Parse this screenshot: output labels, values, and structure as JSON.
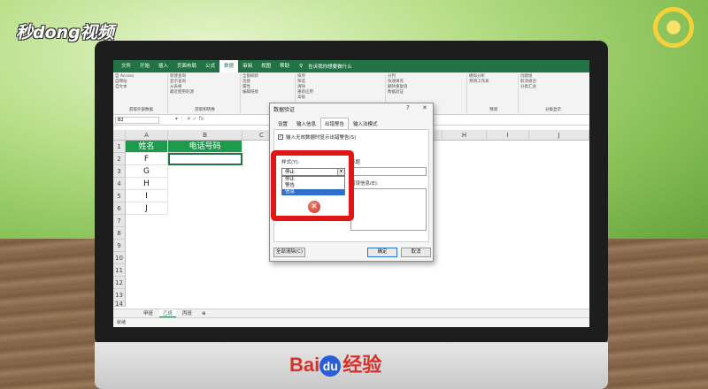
{
  "logo": "秒dong视频",
  "footer_logo": {
    "bai": "Bai",
    "du": "du",
    "jingyan": "经验"
  },
  "ribbon": {
    "tabs": [
      "文件",
      "开始",
      "插入",
      "页面布局",
      "公式",
      "数据",
      "审阅",
      "视图",
      "帮助"
    ],
    "active_tab": "数据",
    "tell_me": "告诉我你想要做什么",
    "groups": [
      {
        "label": "获取外部数据",
        "items": [
          "自 Access",
          "自网站",
          "自文本"
        ]
      },
      {
        "label": "获取和转换",
        "items": [
          "新建查询",
          "显示查询",
          "从表格",
          "最近使用的源"
        ]
      },
      {
        "label": "",
        "items": [
          "全部刷新",
          "连接",
          "属性",
          "编辑链接"
        ]
      },
      {
        "label": "",
        "items": [
          "排序",
          "筛选",
          "清除",
          "重新应用",
          "高级"
        ]
      },
      {
        "label": "",
        "items": [
          "分列",
          "快速填充",
          "删除重复值",
          "数据验证"
        ]
      },
      {
        "label": "预测",
        "items": [
          "模拟分析",
          "预测工作表"
        ]
      },
      {
        "label": "分级显示",
        "items": [
          "创建组",
          "取消组合",
          "分类汇总"
        ]
      }
    ]
  },
  "formula": {
    "name_box": "B2",
    "icons": "▾  ⋮  ✕  ✓  fx"
  },
  "columns": [
    "A",
    "B",
    "C",
    "D",
    "E",
    "F",
    "G",
    "H",
    "I",
    "J"
  ],
  "rows": [
    "1",
    "2",
    "3",
    "4",
    "5",
    "6",
    "7",
    "8",
    "9",
    "10",
    "11",
    "12",
    "13",
    "14"
  ],
  "cells": {
    "a1": "姓名",
    "b1": "电话号码",
    "a2": "F",
    "a3": "G",
    "a4": "H",
    "a5": "I",
    "a6": "J"
  },
  "sheets": [
    "甲班",
    "乙班",
    "丙班"
  ],
  "active_sheet": "乙班",
  "status": "就绪",
  "dialog": {
    "title": "数据验证",
    "help": "?",
    "close": "✕",
    "tabs": [
      "设置",
      "输入信息",
      "出错警告",
      "输入法模式"
    ],
    "active_tab": "出错警告",
    "checkbox_label": "输入无效数据时显示出错警告(S)",
    "checkbox_checked": true,
    "style_label": "样式(Y):",
    "style_value": "停止",
    "style_options": [
      "停止",
      "警告",
      "信息"
    ],
    "highlighted_option": "信息",
    "title_label": "标题",
    "message_label": "错误信息(E):",
    "clear_all": "全部清除(C)",
    "ok": "确定",
    "cancel": "取消"
  },
  "colors": {
    "excel_green": "#217346",
    "header_fill": "#1e9a4d",
    "highlight_red": "#e21515",
    "select_blue": "#2f6fce"
  }
}
